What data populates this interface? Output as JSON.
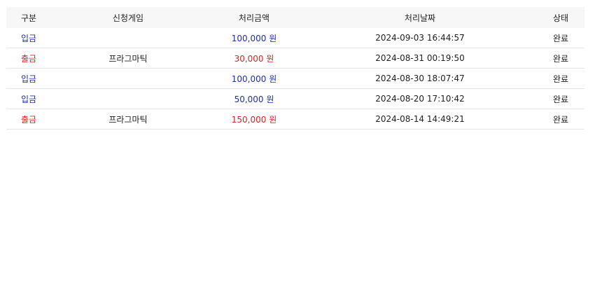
{
  "colors": {
    "deposit": "#1f2fa8",
    "withdraw": "#d42525",
    "header_bg": "#f7f7f7",
    "row_border": "#e6e6e6"
  },
  "table": {
    "headers": [
      "구분",
      "신청게임",
      "처리금액",
      "처리날짜",
      "상태"
    ],
    "rows": [
      {
        "type": "입금",
        "kind": "deposit",
        "game": "",
        "amount": "100,000 원",
        "date": "2024-09-03 16:44:57",
        "status": "완료"
      },
      {
        "type": "출금",
        "kind": "withdraw",
        "game": "프라그마틱",
        "amount": "30,000 원",
        "date": "2024-08-31 00:19:50",
        "status": "완료"
      },
      {
        "type": "입금",
        "kind": "deposit",
        "game": "",
        "amount": "100,000 원",
        "date": "2024-08-30 18:07:47",
        "status": "완료"
      },
      {
        "type": "입금",
        "kind": "deposit",
        "game": "",
        "amount": "50,000 원",
        "date": "2024-08-20 17:10:42",
        "status": "완료"
      },
      {
        "type": "출금",
        "kind": "withdraw",
        "game": "프라그마틱",
        "amount": "150,000 원",
        "date": "2024-08-14 14:49:21",
        "status": "완료"
      }
    ]
  }
}
